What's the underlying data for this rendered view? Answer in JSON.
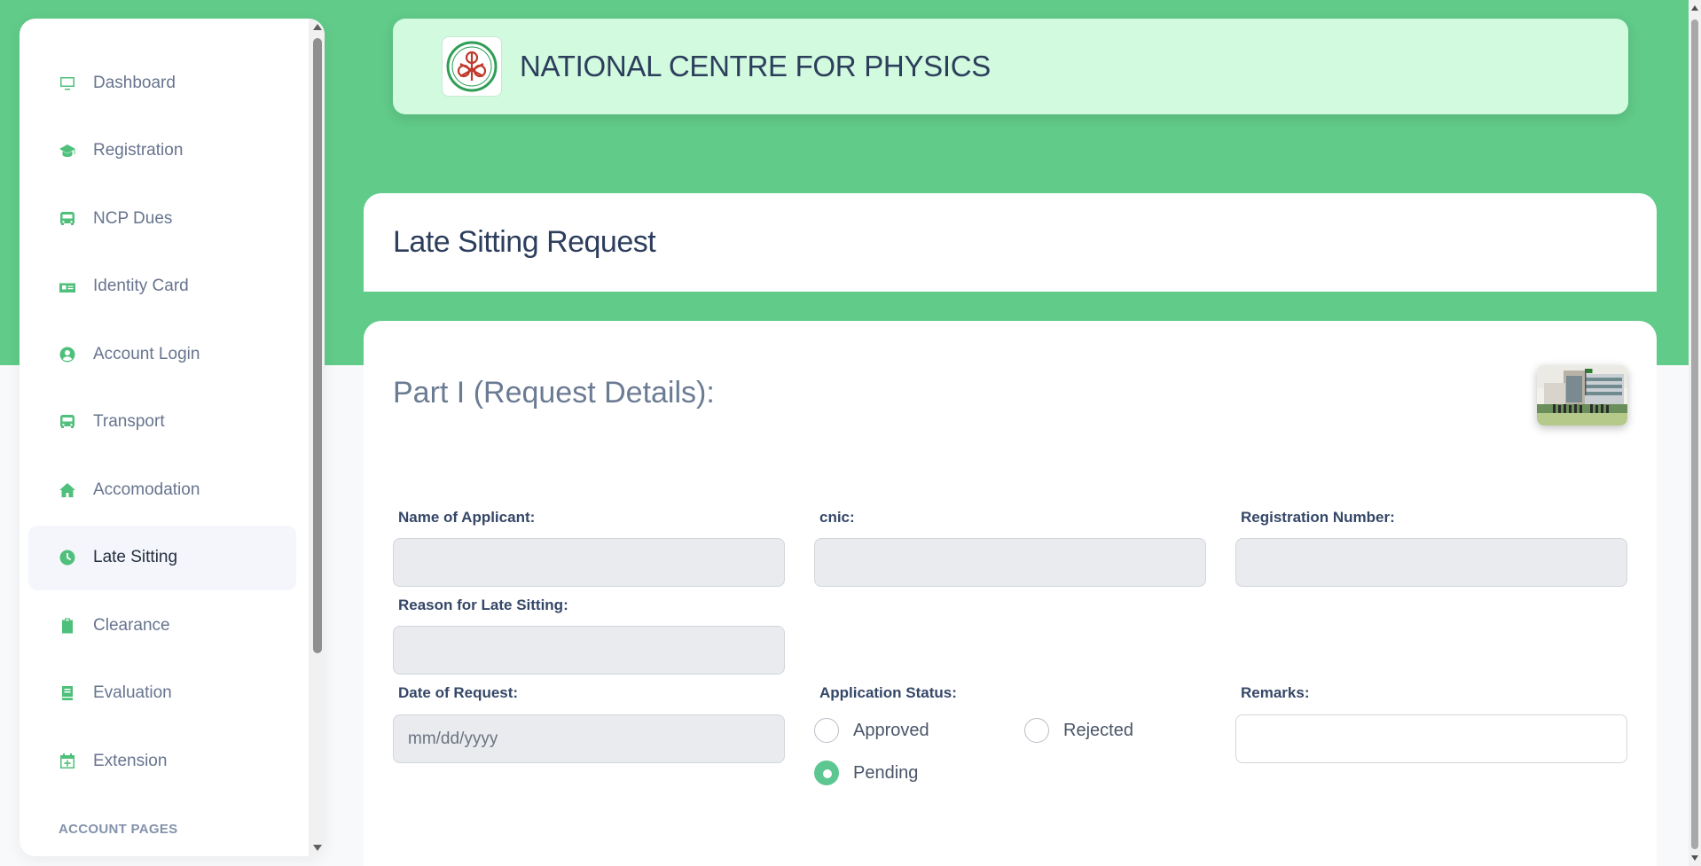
{
  "header": {
    "title": "NATIONAL CENTRE FOR PHYSICS",
    "logo_icon": "ncp-logo-icon"
  },
  "sidebar": {
    "items": [
      {
        "label": "Dashboard",
        "icon": "monitor-icon"
      },
      {
        "label": "Registration",
        "icon": "graduation-cap-icon"
      },
      {
        "label": "NCP Dues",
        "icon": "bus-icon"
      },
      {
        "label": "Identity Card",
        "icon": "id-card-icon"
      },
      {
        "label": "Account Login",
        "icon": "user-circle-icon"
      },
      {
        "label": "Transport",
        "icon": "bus-icon"
      },
      {
        "label": "Accomodation",
        "icon": "home-icon"
      },
      {
        "label": "Late Sitting",
        "icon": "clock-icon",
        "active": true
      },
      {
        "label": "Clearance",
        "icon": "clipboard-icon"
      },
      {
        "label": "Evaluation",
        "icon": "book-icon"
      },
      {
        "label": "Extension",
        "icon": "calendar-plus-icon"
      }
    ],
    "section_title": "ACCOUNT PAGES"
  },
  "page": {
    "title": "Late Sitting Request",
    "part_title": "Part I (Request Details):"
  },
  "form": {
    "name_label": "Name of Applicant:",
    "name_value": "",
    "cnic_label": "cnic:",
    "cnic_value": "",
    "reg_label": "Registration Number:",
    "reg_value": "",
    "reason_label": "Reason for Late Sitting:",
    "reason_value": "",
    "date_label": "Date of Request:",
    "date_placeholder": "mm/dd/yyyy",
    "status_label": "Application Status:",
    "status_options": [
      "Approved",
      "Rejected",
      "Pending"
    ],
    "status_selected": "Pending",
    "remarks_label": "Remarks:",
    "remarks_value": ""
  },
  "colors": {
    "brand_green": "#61cb89",
    "header_bg": "#d1fadf",
    "icon_green": "#4fc07b",
    "radio_checked": "#5dc792"
  }
}
